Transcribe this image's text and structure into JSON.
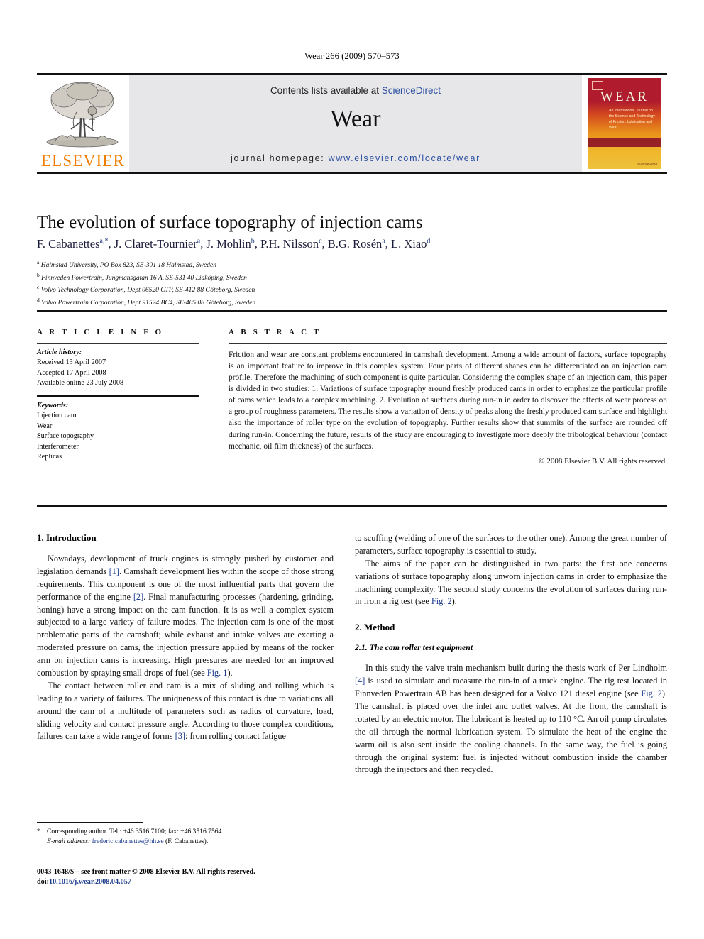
{
  "running_head": "Wear 266 (2009) 570–573",
  "header": {
    "publisher_name": "ELSEVIER",
    "contents_prefix": "Contents lists available at ",
    "contents_link": "ScienceDirect",
    "journal_name": "Wear",
    "homepage_label": "journal homepage: ",
    "homepage_url": "www.elsevier.com/locate/wear",
    "cover": {
      "title": "WEAR",
      "subtitle": "An International Journal on the Science and Technology of Friction, Lubrication and Wear",
      "imprint": "ScienceDirect"
    }
  },
  "article": {
    "title": "The evolution of surface topography of injection cams",
    "authors": [
      {
        "name": "F. Cabanettes",
        "marks": "a,*"
      },
      {
        "name": "J. Claret-Tournier",
        "marks": "a"
      },
      {
        "name": "J. Mohlin",
        "marks": "b"
      },
      {
        "name": "P.H. Nilsson",
        "marks": "c"
      },
      {
        "name": "B.G. Rosén",
        "marks": "a"
      },
      {
        "name": "L. Xiao",
        "marks": "d"
      }
    ],
    "affiliations": [
      {
        "mark": "a",
        "text": "Halmstad University, PO Box 823, SE-301 18 Halmstad, Sweden"
      },
      {
        "mark": "b",
        "text": "Finnveden Powertrain, Jungmansgatan 16 A, SE-531 40 Lidköping, Sweden"
      },
      {
        "mark": "c",
        "text": "Volvo Technology Corporation, Dept 06520 CTP, SE-412 88 Göteborg, Sweden"
      },
      {
        "mark": "d",
        "text": "Volvo Powertrain Corporation, Dept 91524 BC4, SE-405 08 Göteborg, Sweden"
      }
    ]
  },
  "article_info": {
    "heading": "A R T I C L E  I N F O",
    "history_label": "Article history:",
    "history": [
      "Received 13 April 2007",
      "Accepted 17 April 2008",
      "Available online 23 July 2008"
    ],
    "keywords_label": "Keywords:",
    "keywords": [
      "Injection cam",
      "Wear",
      "Surface topography",
      "Interferometer",
      "Replicas"
    ]
  },
  "abstract": {
    "heading": "A B S T R A C T",
    "text": "Friction and wear are constant problems encountered in camshaft development. Among a wide amount of factors, surface topography is an important feature to improve in this complex system. Four parts of different shapes can be differentiated on an injection cam profile. Therefore the machining of such component is quite particular. Considering the complex shape of an injection cam, this paper is divided in two studies: 1. Variations of surface topography around freshly produced cams in order to emphasize the particular profile of cams which leads to a complex machining. 2. Evolution of surfaces during run-in in order to discover the effects of wear process on a group of roughness parameters. The results show a variation of density of peaks along the freshly produced cam surface and highlight also the importance of roller type on the evolution of topography. Further results show that summits of the surface are rounded off during run-in. Concerning the future, results of the study are encouraging to investigate more deeply the tribological behaviour (contact mechanic, oil film thickness) of the surfaces.",
    "copyright": "© 2008 Elsevier B.V. All rights reserved."
  },
  "body": {
    "section1_heading": "1.  Introduction",
    "intro_p1_a": "Nowadays, development of truck engines is strongly pushed by customer and legislation demands ",
    "intro_p1_ref1": "[1]",
    "intro_p1_b": ". Camshaft development lies within the scope of those strong requirements. This component is one of the most influential parts that govern the performance of the engine ",
    "intro_p1_ref2": "[2]",
    "intro_p1_c": ". Final manufacturing processes (hardening, grinding, honing) have a strong impact on the cam function. It is as well a complex system subjected to a large variety of failure modes. The injection cam is one of the most problematic parts of the camshaft; while exhaust and intake valves are exerting a moderated pressure on cams, the injection pressure applied by means of the rocker arm on injection cams is increasing. High pressures are needed for an improved combustion by spraying small drops of fuel (see ",
    "intro_p1_fig1": "Fig. 1",
    "intro_p1_d": ").",
    "intro_p2_a": "The contact between roller and cam is a mix of sliding and rolling which is leading to a variety of failures. The uniqueness of this contact is due to variations all around the cam of a multitude of parameters such as radius of curvature, load, sliding velocity and contact pressure angle. According to those complex conditions, failures can take a wide range of forms ",
    "intro_p2_ref3": "[3]",
    "intro_p2_b": ": from rolling contact fatigue",
    "right_p1": "to scuffing (welding of one of the surfaces to the other one). Among the great number of parameters, surface topography is essential to study.",
    "right_p2_a": "The aims of the paper can be distinguished in two parts: the first one concerns variations of surface topography along unworn injection cams in order to emphasize the machining complexity. The second study concerns the evolution of surfaces during run-in from a rig test (see ",
    "right_p2_fig2": "Fig. 2",
    "right_p2_b": ").",
    "section2_heading": "2.  Method",
    "subsection21_heading": "2.1.  The cam roller test equipment",
    "method_p1_a": "In this study the valve train mechanism built during the thesis work of Per Lindholm ",
    "method_p1_ref4": "[4]",
    "method_p1_b": " is used to simulate and measure the run-in of a truck engine. The rig test located in Finnveden Powertrain AB has been designed for a Volvo 121 diesel engine (see ",
    "method_p1_fig2": "Fig. 2",
    "method_p1_c": "). The camshaft is placed over the inlet and outlet valves. At the front, the camshaft is rotated by an electric motor. The lubricant is heated up to 110 °C. An oil pump circulates the oil through the normal lubrication system. To simulate the heat of the engine the warm oil is also sent inside the cooling channels. In the same way, the fuel is going through the original system: fuel is injected without combustion inside the chamber through the injectors and then recycled."
  },
  "footnotes": {
    "corresponding_marker": "*",
    "corresponding_text": "Corresponding author. Tel.: +46 3516 7100; fax: +46 3516 7564.",
    "email_label": "E-mail address:",
    "email_address": "frederic.cabanettes@hh.se",
    "email_owner": "(F. Cabanettes)."
  },
  "footer": {
    "issn_line": "0043-1648/$ – see front matter © 2008 Elsevier B.V. All rights reserved.",
    "doi_label": "doi:",
    "doi_value": "10.1016/j.wear.2008.04.057"
  },
  "colors": {
    "elsevier_orange": "#F07D00",
    "link_blue": "#2b50a0",
    "ref_blue": "#1f3d8f",
    "header_band": "#e7e7ea"
  }
}
